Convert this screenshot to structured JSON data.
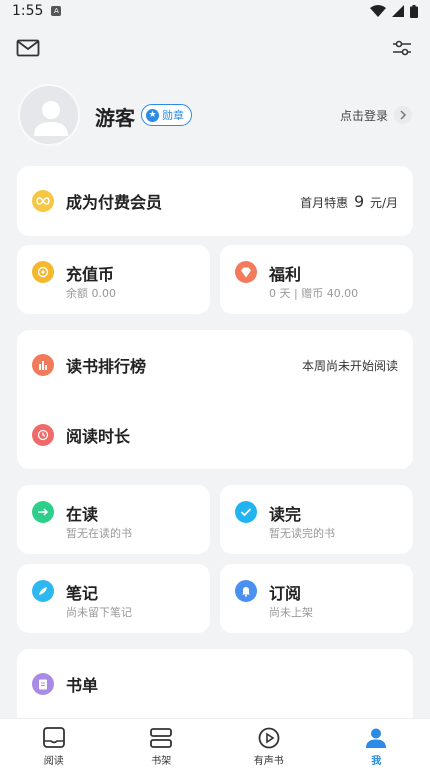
{
  "status": {
    "time": "1:55",
    "sim": "A"
  },
  "profile": {
    "username": "游客",
    "badge": "勋章",
    "login": "点击登录"
  },
  "vip": {
    "title": "成为付费会员",
    "offer_prefix": "首月特惠",
    "offer_price": "9",
    "offer_unit": "元/月"
  },
  "recharge": {
    "title": "充值币",
    "balance": "余额 0.00"
  },
  "welfare": {
    "title": "福利",
    "info": "0 天 | 赠币 40.00"
  },
  "ranking": {
    "title": "读书排行榜",
    "status": "本周尚未开始阅读"
  },
  "duration": {
    "title": "阅读时长"
  },
  "reading": {
    "title": "在读",
    "sub": "暂无在读的书"
  },
  "finished": {
    "title": "读完",
    "sub": "暂无读完的书"
  },
  "notes": {
    "title": "笔记",
    "sub": "尚未留下笔记"
  },
  "subscribe": {
    "title": "订阅",
    "sub": "尚未上架"
  },
  "booklist": {
    "title": "书单"
  },
  "tabs": [
    {
      "label": "阅读",
      "icon": "tablet-icon"
    },
    {
      "label": "书架",
      "icon": "bookshelf-icon"
    },
    {
      "label": "有声书",
      "icon": "play-circle-icon"
    },
    {
      "label": "我",
      "icon": "person-icon"
    }
  ],
  "colors": {
    "accent": "#2b8be6",
    "vip": "#f6c744",
    "recharge": "#f5b72e",
    "welfare": "#f37a5a",
    "ranking": "#f07a5a",
    "duration": "#f06a6a",
    "reading": "#2ecf8b",
    "finished": "#22b4f0",
    "notes": "#2fb8ef",
    "subscribe": "#4a90f0",
    "booklist": "#a98be6"
  }
}
